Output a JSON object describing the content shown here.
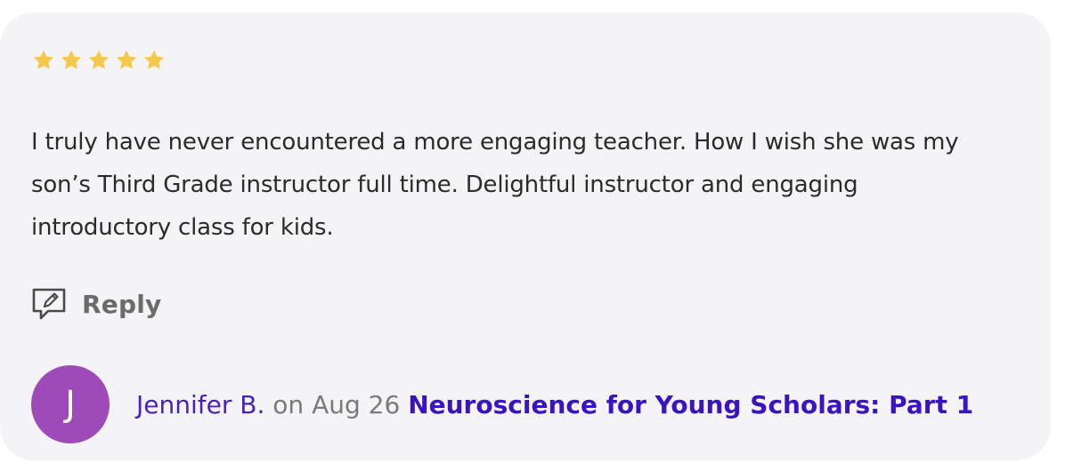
{
  "review": {
    "rating": 5,
    "rating_max": 5,
    "star_color": "#f5c84c",
    "text": "I truly have never encountered a more engaging teacher. How I wish she was my son’s Third Grade instructor full time. Delightful instructor and engaging introductory class for kids.",
    "reply_icon": "reply-speech-bubble-icon",
    "reply_label": "Reply",
    "avatar_initial": "J",
    "avatar_color": "#9e4bb9",
    "author": "Jennifer B.",
    "date_prefix": "on",
    "date": "Aug 26",
    "course_title": "Neuroscience for Young Scholars: Part 1",
    "link_color": "#3a14c2"
  }
}
